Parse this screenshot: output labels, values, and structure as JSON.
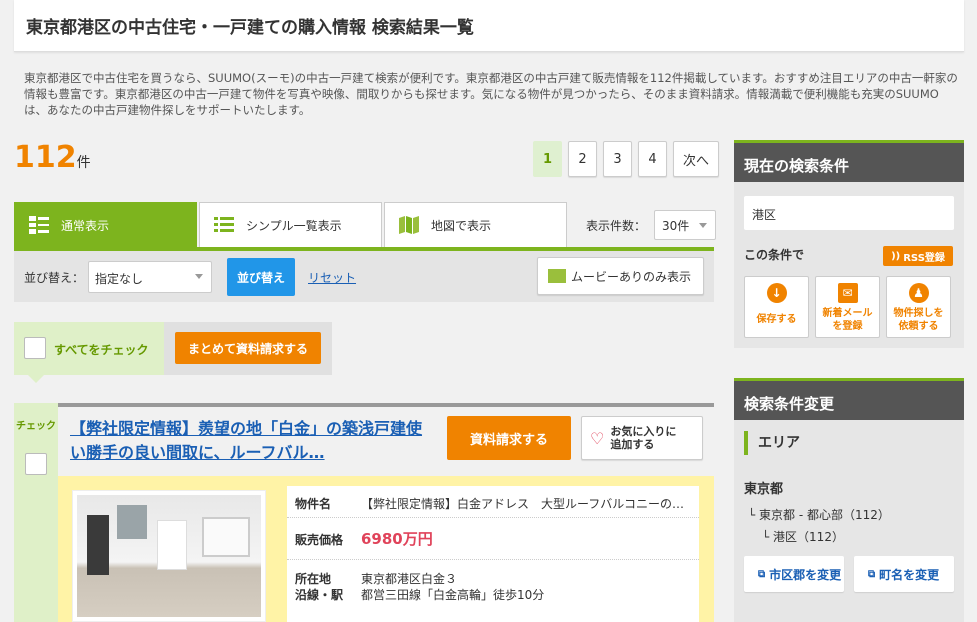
{
  "page_title": "東京都港区の中古住宅・一戸建ての購入情報 検索結果一覧",
  "intro": "東京都港区で中古住宅を買うなら、SUUMO(スーモ)の中古一戸建て検索が便利です。東京都港区の中古戸建て販売情報を112件掲載しています。おすすめ注目エリアの中古一軒家の情報も豊富です。東京都港区の中古一戸建て物件を写真や映像、間取りからも探せます。気になる物件が見つかったら、そのまま資料請求。情報満載で便利機能も充実のSUUMOは、あなたの中古戸建物件探しをサポートいたします。",
  "result_count": "112",
  "result_unit": "件",
  "pager": {
    "pages": [
      "1",
      "2",
      "3",
      "4"
    ],
    "next": "次へ",
    "current": "1"
  },
  "tabs": {
    "normal": "通常表示",
    "simple": "シンプル一覧表示",
    "map": "地図で表示"
  },
  "per_page": {
    "label": "表示件数：",
    "value": "30件"
  },
  "sort": {
    "label": "並び替え：",
    "value": "指定なし",
    "button": "並び替え",
    "reset": "リセット",
    "movie": "ムービーありのみ表示"
  },
  "bulk": {
    "check_all": "すべてをチェック",
    "request": "まとめて資料請求する"
  },
  "listing": {
    "check_label": "チェック",
    "title": "【弊社限定情報】羨望の地「白金」の築浅戸建使い勝手の良い間取に、ルーフバル…",
    "request_button": "資料請求する",
    "fav_line1": "お気に入りに",
    "fav_line2": "追加する",
    "name_label": "物件名",
    "name_value": "【弊社限定情報】白金アドレス　大型ルーフバルコニーの…",
    "price_label": "販売価格",
    "price_value": "6980万円",
    "location_label": "所在地",
    "location_value": "東京都港区白金３",
    "station_label": "沿線・駅",
    "station_value": "都営三田線「白金高輪」徒歩10分"
  },
  "side_conditions": {
    "heading": "現在の検索条件",
    "area": "港区",
    "condition_label": "この条件で",
    "rss": "RSS登録",
    "save": "保存する",
    "mail_line1": "新着メール",
    "mail_line2": "を登録",
    "request_line1": "物件探しを",
    "request_line2": "依頼する"
  },
  "side_change": {
    "heading": "検索条件変更",
    "area_heading": "エリア",
    "pref": "東京都",
    "region": "東京都 - 都心部（112）",
    "ward": "港区（112）",
    "change_city": "市区郡を変更",
    "change_town": "町名を変更"
  },
  "colors": {
    "green": "#7db41e",
    "orange": "#f08300",
    "link": "#1a5fb4",
    "price": "#e0435a"
  }
}
